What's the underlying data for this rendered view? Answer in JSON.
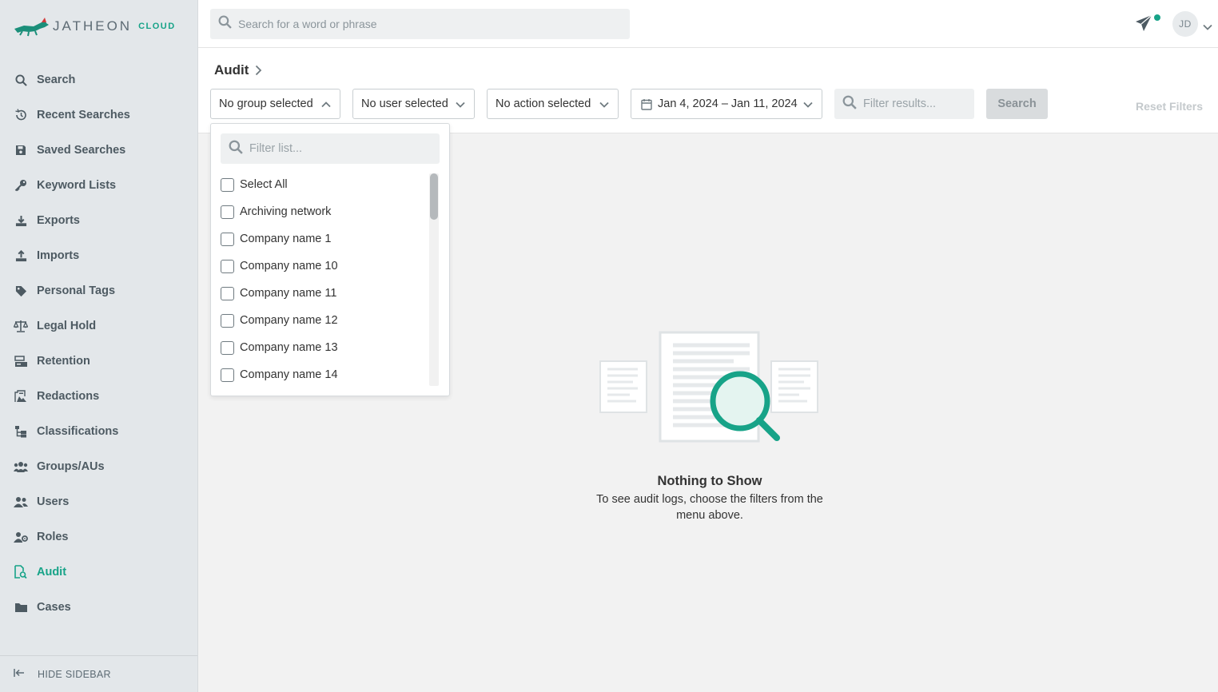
{
  "brand": {
    "name": "JATHEON",
    "suffix": "CLOUD",
    "accent": "#17a388"
  },
  "topbar": {
    "search_placeholder": "Search for a word or phrase",
    "avatar_initials": "JD"
  },
  "sidebar": {
    "items": [
      {
        "label": "Search",
        "icon": "search-icon"
      },
      {
        "label": "Recent Searches",
        "icon": "history-icon"
      },
      {
        "label": "Saved Searches",
        "icon": "save-icon"
      },
      {
        "label": "Keyword Lists",
        "icon": "key-icon"
      },
      {
        "label": "Exports",
        "icon": "download-icon"
      },
      {
        "label": "Imports",
        "icon": "upload-icon"
      },
      {
        "label": "Personal Tags",
        "icon": "tag-icon"
      },
      {
        "label": "Legal Hold",
        "icon": "scale-icon"
      },
      {
        "label": "Retention",
        "icon": "archive-icon"
      },
      {
        "label": "Redactions",
        "icon": "redact-icon"
      },
      {
        "label": "Classifications",
        "icon": "tree-icon"
      },
      {
        "label": "Groups/AUs",
        "icon": "groups-icon"
      },
      {
        "label": "Users",
        "icon": "users-icon"
      },
      {
        "label": "Roles",
        "icon": "roles-icon"
      },
      {
        "label": "Audit",
        "icon": "audit-icon",
        "active": true
      },
      {
        "label": "Cases",
        "icon": "folder-icon"
      }
    ],
    "hide_label": "HIDE SIDEBAR"
  },
  "breadcrumb": {
    "title": "Audit"
  },
  "filters": {
    "group": "No group selected",
    "user": "No user selected",
    "action": "No action selected",
    "date_range": "Jan 4, 2024 – Jan 11, 2024",
    "results_placeholder": "Filter results...",
    "search_button": "Search",
    "reset_button": "Reset Filters"
  },
  "group_dropdown": {
    "filter_placeholder": "Filter list...",
    "options": [
      "Select All",
      "Archiving network",
      "Company name 1",
      "Company name 10",
      "Company name 11",
      "Company name 12",
      "Company name 13",
      "Company name 14"
    ]
  },
  "empty_state": {
    "title": "Nothing to Show",
    "message": "To see audit logs, choose the filters from the menu above."
  }
}
